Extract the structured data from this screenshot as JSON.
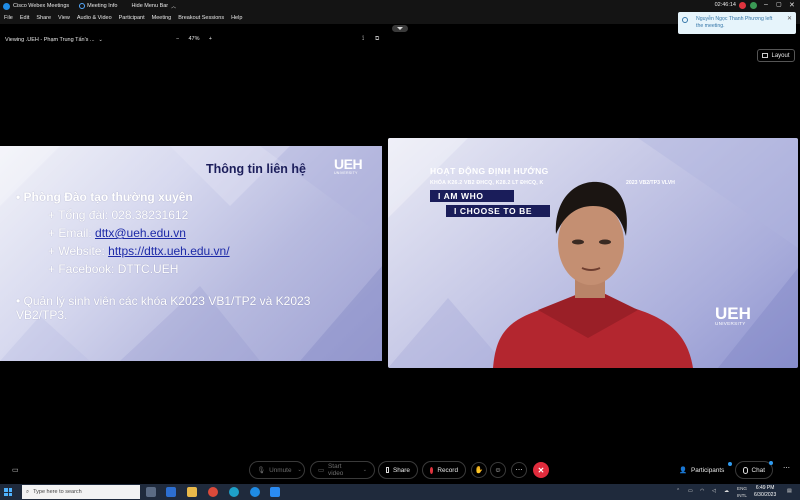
{
  "window": {
    "app_title": "Cisco Webex Meetings",
    "meeting_info": "Meeting Info",
    "hide_menu_bar": "Hide Menu Bar",
    "timer": "02:46:14"
  },
  "menu": {
    "items": [
      "File",
      "Edit",
      "Share",
      "View",
      "Audio & Video",
      "Participant",
      "Meeting",
      "Breakout Sessions",
      "Help"
    ]
  },
  "share_toolbar": {
    "viewing": "Viewing .UEH - Phạm Trung Tấn's ...",
    "zoom_out": "−",
    "zoom_level": "47%",
    "zoom_in": "+"
  },
  "notification": {
    "text": "Nguyễn Ngọc Thanh Phương left the meeting."
  },
  "layout_button": {
    "label": "Layout"
  },
  "slide": {
    "title": "Thông tin liên hệ",
    "logo_main": "UEH",
    "logo_sub": "UNIVERSITY",
    "heading": "• Phòng Đào tạo thường xuyên",
    "phone_label": "+ Tổng đài: ",
    "phone_value": "028.38231612",
    "email_label": "+ Email: ",
    "email_value": "dttx@ueh.edu.vn",
    "website_label": "+ Website: ",
    "website_value": "https://dttx.ueh.edu.vn/",
    "facebook_label": "+ Facebook: ",
    "facebook_value": "DTTC.UEH",
    "note": "• Quản lý sinh viên các khóa K2023 VB1/TP2 và K2023 VB2/TP3."
  },
  "video": {
    "banner_title": "HOẠT ĐỘNG ĐỊNH HƯỚNG",
    "banner_subtitle": "KHÓA K26.2 VB2 ĐHCQ, K28.2 LT ĐHCQ, K",
    "banner_subtitle_end": "2023 VB2/TP3 VLVH",
    "tag1": "I AM WHO",
    "tag2": "I CHOOSE TO BE",
    "logo_main": "UEH",
    "logo_sub": "UNIVERSITY"
  },
  "controls": {
    "unmute": "Unmute",
    "start_video": "Start video",
    "share": "Share",
    "record": "Record",
    "participants": "Participants",
    "chat": "Chat"
  },
  "taskbar": {
    "search_placeholder": "Type here to search",
    "lang1": "ENG",
    "lang2": "INTL",
    "time": "6:49 PM",
    "date": "6/30/2023"
  },
  "colors": {
    "slide_title": "#1c1e5b",
    "link": "#1d2aa8",
    "tag_bg": "#1a1d5a",
    "leave_red": "#e02b3c",
    "toast_bg": "#e6f4fb",
    "taskbar_bg": "#1f2a3c"
  },
  "icons": [
    "webex-icon",
    "info-icon",
    "chevron-up-icon",
    "pin-icon",
    "close-icon",
    "layout-icon",
    "microphone-icon",
    "camera-icon",
    "share-icon",
    "record-icon",
    "reactions-icon",
    "more-icon",
    "leave-icon",
    "participants-icon",
    "chat-icon",
    "windows-icon",
    "search-icon"
  ]
}
